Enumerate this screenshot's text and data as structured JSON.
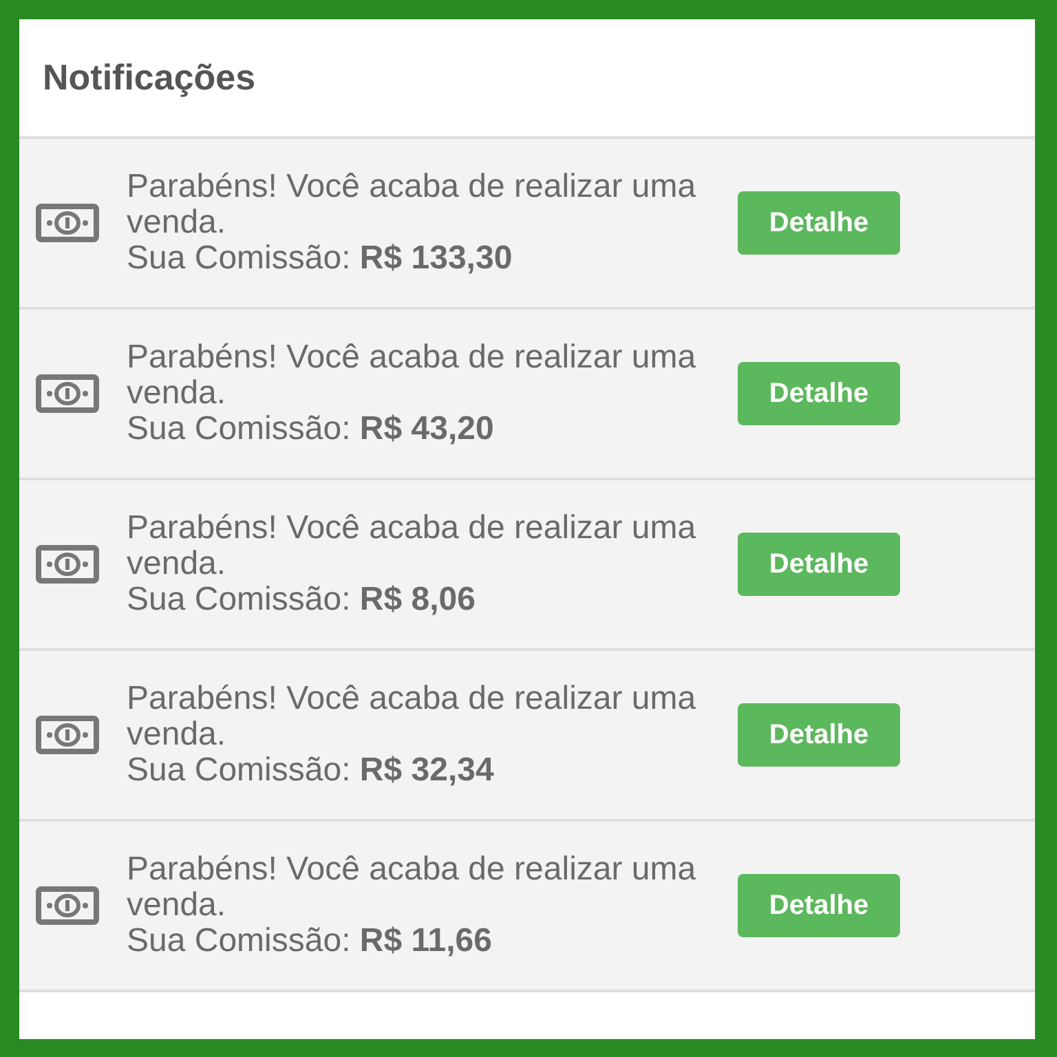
{
  "panel": {
    "title": "Notificações"
  },
  "notifications": [
    {
      "message": "Parabéns! Você acaba de realizar uma venda.",
      "commission": "Sua Comissão: **R$ 133,30**",
      "button": "Detalhe"
    },
    {
      "message": "Parabéns! Você acaba de realizar uma venda.",
      "commission": "Sua Comissão: **R$ 43,20**",
      "button": "Detalhe"
    },
    {
      "message": "Parabéns! Você acaba de realizar uma venda.",
      "commission": "Sua Comissão: **R$ 8,06**",
      "button": "Detalhe"
    },
    {
      "message": "Parabéns! Você acaba de realizar uma venda.",
      "commission": "Sua Comissão: **R$ 32,34**",
      "button": "Detalhe"
    },
    {
      "message": "Parabéns! Você acaba de realizar uma venda.",
      "commission": "Sua Comissão: **R$ 11,66**",
      "button": "Detalhe"
    }
  ]
}
